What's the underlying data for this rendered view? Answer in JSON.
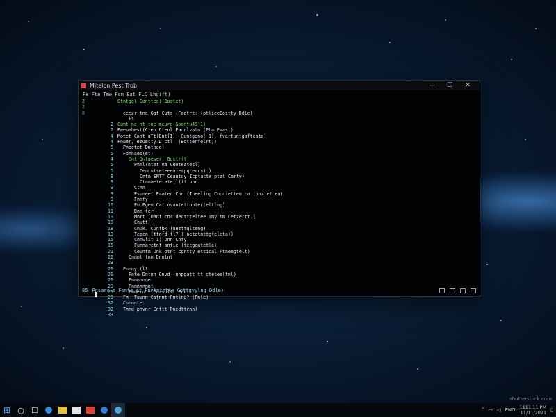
{
  "window": {
    "title": "Mitelon Pest Trob",
    "menu": "Fe Fte Tme Fsm Eat FLC Lhg(ft)",
    "controls": [
      "—",
      "☐",
      "✕"
    ]
  },
  "gutter_marks": [
    "2",
    "2",
    "0"
  ],
  "code_lines": [
    {
      "num": "",
      "text": "Ctntgel Contteel Bostet)",
      "color": "green",
      "indent": 0
    },
    {
      "num": "",
      "text": "",
      "color": "white",
      "indent": 0
    },
    {
      "num": "",
      "text": "ceezr tne Gat Cuts (Fadtrt: {ptlieeEostty Ddle)",
      "color": "white",
      "indent": 2
    },
    {
      "num": "",
      "text": "Fs",
      "color": "white",
      "indent": 4
    },
    {
      "num": "2",
      "text": "Cunt ne nt tne mcure Goantu4S'1)",
      "color": "green",
      "indent": 0
    },
    {
      "num": "2",
      "text": "Feemabest(Cteo Ctenl Eaorlvatn (Pta Ewast)",
      "color": "white",
      "indent": 0
    },
    {
      "num": "4",
      "text": "Motet Cnnt aTt(Bnt[1), Cuntgeno( 1), fvertuntgafteata)",
      "color": "white",
      "indent": 0
    },
    {
      "num": "4",
      "text": "Fnuer, ezuetty D'ctl| (Botterfelrt;)",
      "color": "white",
      "indent": 0
    },
    {
      "num": "5",
      "text": "Pnoctet Dntnee)",
      "color": "white",
      "indent": 2
    },
    {
      "num": "5",
      "text": "Fonnaes(et)",
      "color": "white",
      "indent": 2
    },
    {
      "num": "4",
      "text": "Gnt Gntaeser( Gostr(t)",
      "color": "green",
      "indent": 4
    },
    {
      "num": "5",
      "text": "Pnnl(ntet na Ceoteatetl)",
      "color": "white",
      "indent": 6
    },
    {
      "num": "5",
      "text": "Cencutseteeea-erpqceacs) )",
      "color": "white",
      "indent": 8
    },
    {
      "num": "8",
      "text": "Cntn ENTT Ceantdy Icptacte ptat Carty)",
      "color": "white",
      "indent": 8
    },
    {
      "num": "9",
      "text": "Ctnnaeterate(l(it unn",
      "color": "white",
      "indent": 8
    },
    {
      "num": "9",
      "text": "Ctnn",
      "color": "white",
      "indent": 6
    },
    {
      "num": "9",
      "text": "Fsuneet Eaaten Cnn {Ineeling Cnocietteu ca (pnztet ea)",
      "color": "white",
      "indent": 6
    },
    {
      "num": "9",
      "text": "Fnnfy",
      "color": "white",
      "indent": 6
    },
    {
      "num": "10",
      "text": "Fn Fgen Cat nvantettonterteltlng)",
      "color": "white",
      "indent": 6
    },
    {
      "num": "11",
      "text": "Dnn fer",
      "color": "white",
      "indent": 6
    },
    {
      "num": "10",
      "text": "Mnrt [Dant cnr decttteltee Tmy tm Cetzettt.]",
      "color": "white",
      "indent": 6
    },
    {
      "num": "18",
      "text": "Cnutt",
      "color": "white",
      "indent": 6
    },
    {
      "num": "18",
      "text": "Cnuk. Cuntbk (uezttqlteng)",
      "color": "white",
      "indent": 6
    },
    {
      "num": "13",
      "text": "Tepcn (ttnfd-fl7 ( netetnttgfeleta))",
      "color": "white",
      "indent": 6
    },
    {
      "num": "15",
      "text": "Cnnwlit 1) Dnn Cnty",
      "color": "white",
      "indent": 6
    },
    {
      "num": "15",
      "text": "Funnaretnt antie (tecgeatetle)",
      "color": "white",
      "indent": 6
    },
    {
      "num": "21",
      "text": "Ceuntn Unk ptnt cgntty ettical Ptneegtelt)",
      "color": "white",
      "indent": 6
    },
    {
      "num": "22",
      "text": "Cnnnt tnn Dnntnt",
      "color": "white",
      "indent": 4
    },
    {
      "num": "23",
      "text": "",
      "color": "white",
      "indent": 0
    },
    {
      "num": "26",
      "text": "Fnnnyt(lt:",
      "color": "white",
      "indent": 2
    },
    {
      "num": "26",
      "text": "Fnte Dntnn Gnvd (nnpgatt tt cteteeltnl)",
      "color": "white",
      "indent": 4
    },
    {
      "num": "26",
      "text": "Fnnnnnne",
      "color": "white",
      "indent": 4
    },
    {
      "num": "29",
      "text": "Fnnnnnnnt",
      "color": "white",
      "indent": 4
    },
    {
      "num": "25",
      "text": "Fnnern - Cnrsultt Fnb",
      "color": "white",
      "indent": 4
    },
    {
      "num": "28",
      "text": "Fn  Tuunn Catnnt Fntlng? (Fnle)",
      "color": "white",
      "indent": 2
    },
    {
      "num": "32",
      "text": "Cnnnnte",
      "color": "white",
      "indent": 2
    },
    {
      "num": "32",
      "text": "Tnnd pnvnr Cnttt Pnedttrnn)",
      "color": "white",
      "indent": 2
    },
    {
      "num": "33",
      "text": "",
      "color": "white",
      "indent": 0
    }
  ],
  "status": {
    "prefix": "85",
    "text": "Pnsarcls Fsnte ef Fnntntntte Cnttgyylng Ddle)"
  },
  "taskbar": {
    "start_icon": "windows-logo-icon",
    "items": [
      "search-icon",
      "task-view-icon",
      "edge-icon",
      "file-explorer-icon",
      "store-icon",
      "media-icon",
      "app-icon",
      "terminal-icon"
    ],
    "tray_label": "ENG",
    "time": "1111:11 PM",
    "date": "11/11/2021"
  },
  "watermark": "shutterstock.com",
  "colors": {
    "green": "#7fdc6a",
    "white": "#e3e6ea",
    "cyan": "#8fd1e6",
    "red": "#ff6a5a"
  }
}
